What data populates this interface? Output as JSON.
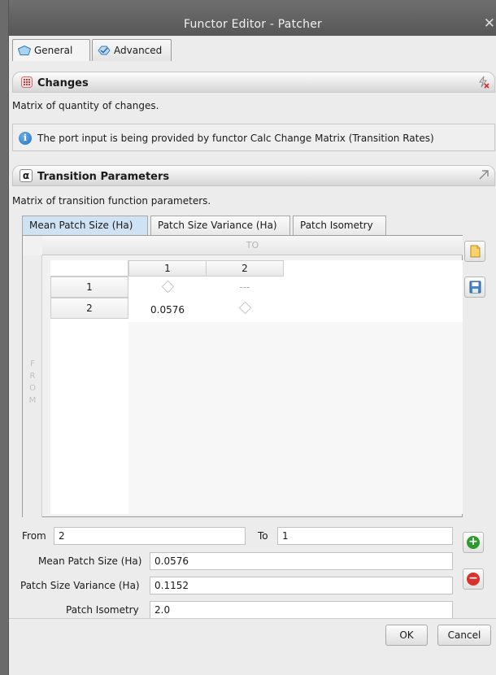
{
  "window": {
    "title": "Functor Editor - Patcher",
    "close_glyph": "✕"
  },
  "top_tabs": [
    {
      "label": "General",
      "icon": "pentagon-icon",
      "active": true
    },
    {
      "label": "Advanced",
      "icon": "badge-icon",
      "active": false
    }
  ],
  "changes": {
    "title": "Changes",
    "description": "Matrix of quantity of changes.",
    "info": "The port input is being provided by functor Calc Change Matrix (Transition Rates)"
  },
  "transition": {
    "title": "Transition Parameters",
    "alpha": "α",
    "description": "Matrix of transition function parameters.",
    "tabs": [
      {
        "label": "Mean Patch Size (Ha)",
        "active": true
      },
      {
        "label": "Patch Size Variance (Ha)",
        "active": false
      },
      {
        "label": "Patch Isometry",
        "active": false
      }
    ],
    "matrix": {
      "to_label": "TO",
      "from_letters": [
        "F",
        "R",
        "O",
        "M"
      ],
      "col_headers": [
        "1",
        "2"
      ],
      "rows": [
        {
          "header": "1",
          "cells": [
            "◇",
            "---"
          ]
        },
        {
          "header": "2",
          "cells": [
            "0.0576",
            "◇"
          ]
        }
      ]
    }
  },
  "form": {
    "from_label": "From",
    "from_value": "2",
    "to_label": "To",
    "to_value": "1",
    "mean_label": "Mean Patch Size (Ha)",
    "mean_value": "0.0576",
    "variance_label": "Patch Size Variance (Ha)",
    "variance_value": "0.1152",
    "isometry_label": "Patch Isometry",
    "isometry_value": "2.0"
  },
  "buttons": {
    "ok": "OK",
    "cancel": "Cancel"
  },
  "colors": {
    "add": "#2e9a2e",
    "remove": "#d8322f",
    "info": "#1f6db8",
    "title_bar": "#606060"
  }
}
